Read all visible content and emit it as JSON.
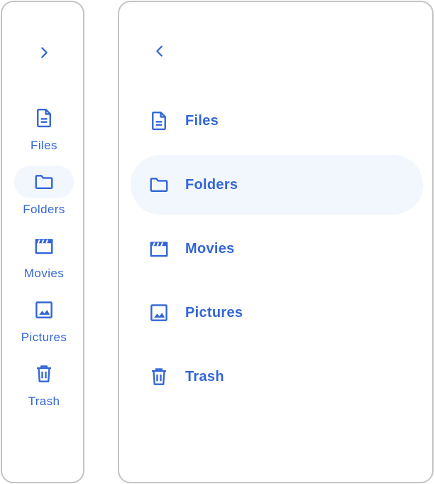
{
  "colors": {
    "accent": "#3266d6",
    "active_background": "#f2f6fd",
    "border": "#c4c4c4"
  },
  "rail": {
    "toggle_icon": "chevron-right-icon",
    "active_index": 1,
    "items": [
      {
        "label": "Files",
        "icon": "file-icon"
      },
      {
        "label": "Folders",
        "icon": "folder-icon"
      },
      {
        "label": "Movies",
        "icon": "movie-icon"
      },
      {
        "label": "Pictures",
        "icon": "image-icon"
      },
      {
        "label": "Trash",
        "icon": "trash-icon"
      }
    ]
  },
  "drawer": {
    "toggle_icon": "chevron-left-icon",
    "active_index": 1,
    "items": [
      {
        "label": "Files",
        "icon": "file-icon"
      },
      {
        "label": "Folders",
        "icon": "folder-icon"
      },
      {
        "label": "Movies",
        "icon": "movie-icon"
      },
      {
        "label": "Pictures",
        "icon": "image-icon"
      },
      {
        "label": "Trash",
        "icon": "trash-icon"
      }
    ]
  }
}
